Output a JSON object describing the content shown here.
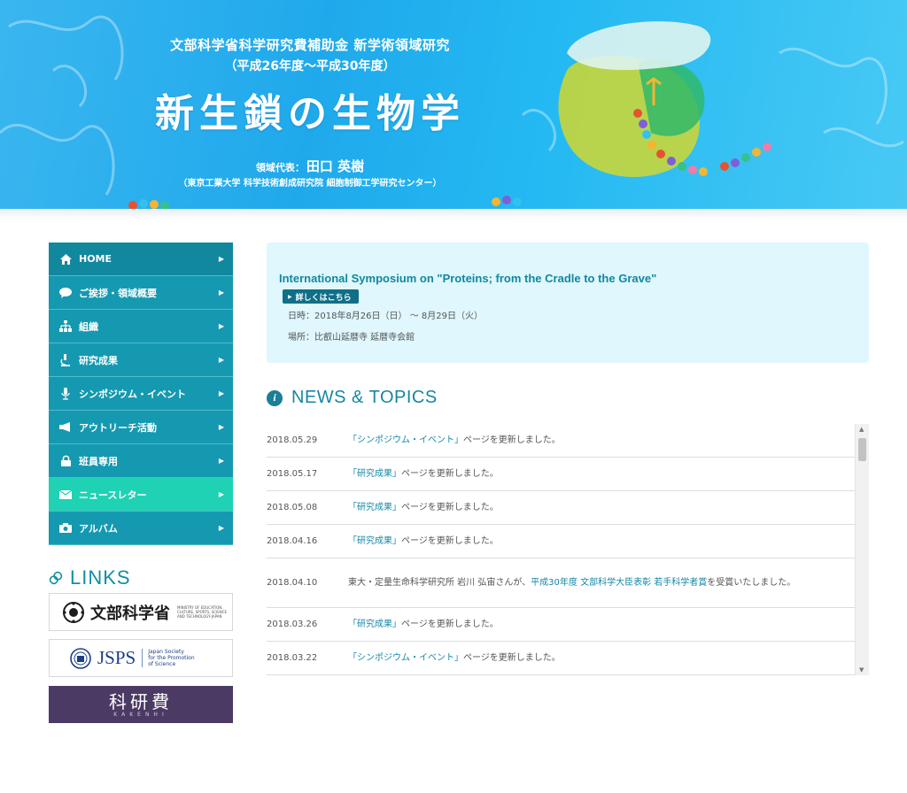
{
  "banner": {
    "line1": "文部科学省科学研究費補助金 新学術領域研究",
    "line2": "（平成26年度〜平成30年度）",
    "title": "新生鎖の生物学",
    "leader_label": "領域代表：",
    "leader_name": "田口 英樹",
    "affiliation": "（東京工業大学 科学技術創成研究院 細胞制御工学研究センター）"
  },
  "menu": {
    "items": [
      {
        "label": "HOME",
        "icon": "home-icon"
      },
      {
        "label": "ご挨拶・領域概要",
        "icon": "speech-bubble-icon"
      },
      {
        "label": "組織",
        "icon": "org-chart-icon"
      },
      {
        "label": "研究成果",
        "icon": "microscope-icon"
      },
      {
        "label": "シンポジウム・イベント",
        "icon": "microphone-icon"
      },
      {
        "label": "アウトリーチ活動",
        "icon": "megaphone-icon"
      },
      {
        "label": "班員専用",
        "icon": "lock-icon"
      },
      {
        "label": "ニュースレター",
        "icon": "mail-icon"
      },
      {
        "label": "アルバム",
        "icon": "camera-icon"
      }
    ],
    "active_index": 7
  },
  "links": {
    "heading": "LINKS",
    "mext_name": "文部科学省",
    "mext_sub": "MINISTRY OF EDUCATION, CULTURE, SPORTS, SCIENCE AND TECHNOLOGY-JAPAN",
    "jsps_name": "JSPS",
    "jsps_sub1": "Japan Society",
    "jsps_sub2": "for the Promotion",
    "jsps_sub3": "of Science",
    "kakenhi_name": "科研費",
    "kakenhi_sub": "KAKENHI"
  },
  "symposium": {
    "title": "International Symposium on \"Proteins; from the Cradle to the Grave\"",
    "button_label": "詳しくはこちら",
    "date": "日時：2018年8月26日（日） 〜 8月29日（火）",
    "place": "場所：比叡山延暦寺 延暦寺会館"
  },
  "news": {
    "heading": "NEWS & TOPICS",
    "rows": [
      {
        "date": "2018.05.29",
        "pre": "",
        "link": "「シンポジウム・イベント」",
        "post": "ページを更新しました。"
      },
      {
        "date": "2018.05.17",
        "pre": "",
        "link": "「研究成果」",
        "post": "ページを更新しました。"
      },
      {
        "date": "2018.05.08",
        "pre": "",
        "link": "「研究成果」",
        "post": "ページを更新しました。"
      },
      {
        "date": "2018.04.16",
        "pre": "",
        "link": "「研究成果」",
        "post": "ページを更新しました。"
      },
      {
        "date": "2018.04.10",
        "pre": "東大・定量生命科学研究所 岩川 弘宙さんが、",
        "link": "平成30年度 文部科学大臣表彰 若手科学者賞",
        "post": "を受賞いたしました。"
      },
      {
        "date": "2018.03.26",
        "pre": "",
        "link": "「研究成果」",
        "post": "ページを更新しました。"
      },
      {
        "date": "2018.03.22",
        "pre": "",
        "link": "「シンポジウム・イベント」",
        "post": "ページを更新しました。"
      }
    ]
  },
  "colors": {
    "menu_bg": "#1599b0",
    "menu_active": "#1fd2b4",
    "accent": "#12889f",
    "symposium_bg": "#dff7fd",
    "kakenhi_bg": "#4b3a64"
  }
}
